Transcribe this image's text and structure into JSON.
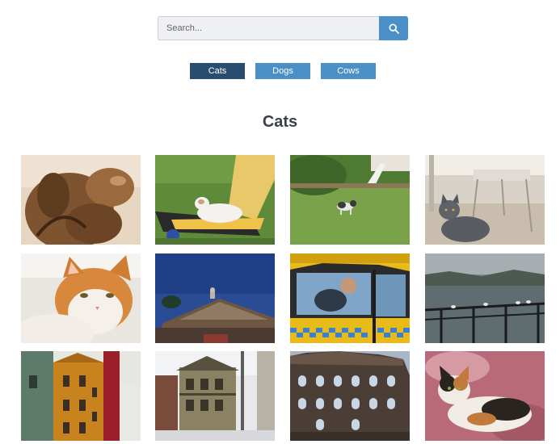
{
  "search": {
    "placeholder": "Search...",
    "icon": "search-icon",
    "button_color": "#4a8fc6"
  },
  "filters": [
    {
      "label": "Cats",
      "active": true
    },
    {
      "label": "Dogs",
      "active": false
    },
    {
      "label": "Cows",
      "active": false
    }
  ],
  "colors": {
    "active_filter": "#284d6e",
    "inactive_filter": "#4a8fc6",
    "heading": "#3a3f48"
  },
  "gallery": {
    "heading": "Cats",
    "photos": [
      {
        "subject": "bronze cat statue"
      },
      {
        "subject": "white cat lying on yellow bench"
      },
      {
        "subject": "cat walking on grass"
      },
      {
        "subject": "grey cat on floor under chairs"
      },
      {
        "subject": "orange and white cat portrait"
      },
      {
        "subject": "cat on rooftop against blue sky"
      },
      {
        "subject": "yellow taxi with checkered stripe"
      },
      {
        "subject": "seaside railing with seagulls"
      },
      {
        "subject": "colorful old houses on street"
      },
      {
        "subject": "old wooden house with balconies"
      },
      {
        "subject": "ruined stone building facade"
      },
      {
        "subject": "calico cat lying on cushion"
      }
    ]
  }
}
